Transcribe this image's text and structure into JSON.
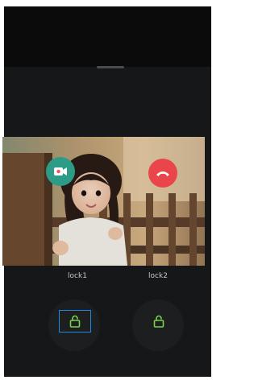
{
  "locks": [
    {
      "label": "lock1",
      "icon": "unlock-icon",
      "color": "#76d44a",
      "focused": true
    },
    {
      "label": "lock2",
      "icon": "unlock-icon",
      "color": "#76d44a",
      "focused": false
    }
  ],
  "call_actions": {
    "accept": {
      "icon": "video-camera-icon",
      "color": "#2c9c87"
    },
    "hangup": {
      "icon": "phone-hangup-icon",
      "color": "#e9454a"
    }
  },
  "colors": {
    "background": "#111214",
    "sheet": "#161718",
    "focus_outline": "#1e88e5"
  }
}
